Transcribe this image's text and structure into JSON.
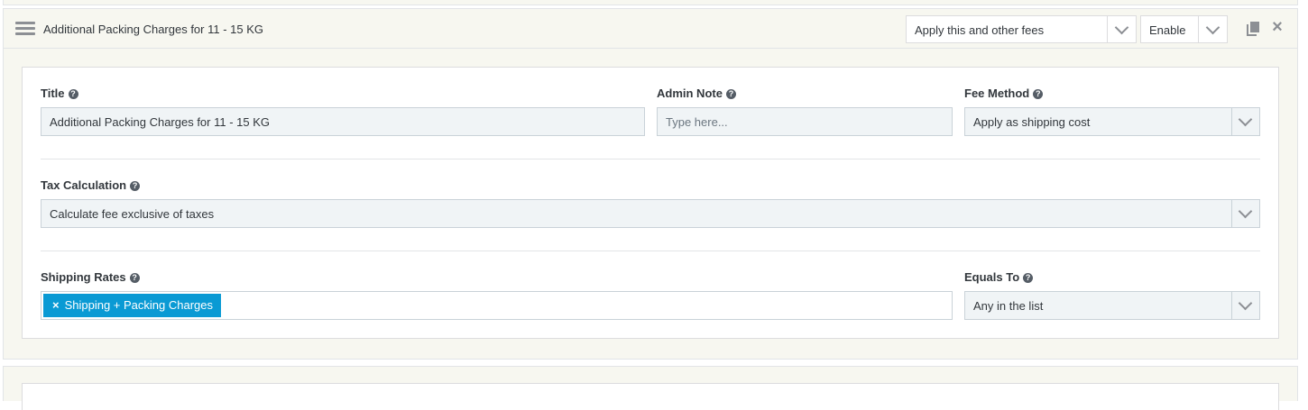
{
  "panel": {
    "title": "Additional Packing Charges for 11 - 15 KG",
    "apply_mode": "Apply this and other fees",
    "status": "Enable"
  },
  "form": {
    "title": {
      "label": "Title",
      "value": "Additional Packing Charges for 11 - 15 KG"
    },
    "admin_note": {
      "label": "Admin Note",
      "placeholder": "Type here..."
    },
    "fee_method": {
      "label": "Fee Method",
      "value": "Apply as shipping cost"
    },
    "tax_calculation": {
      "label": "Tax Calculation",
      "value": "Calculate fee exclusive of taxes"
    },
    "shipping_rates": {
      "label": "Shipping Rates",
      "tags": [
        "Shipping + Packing Charges"
      ],
      "remove_glyph": "×"
    },
    "equals_to": {
      "label": "Equals To",
      "value": "Any in the list"
    }
  },
  "help_glyph": "?"
}
